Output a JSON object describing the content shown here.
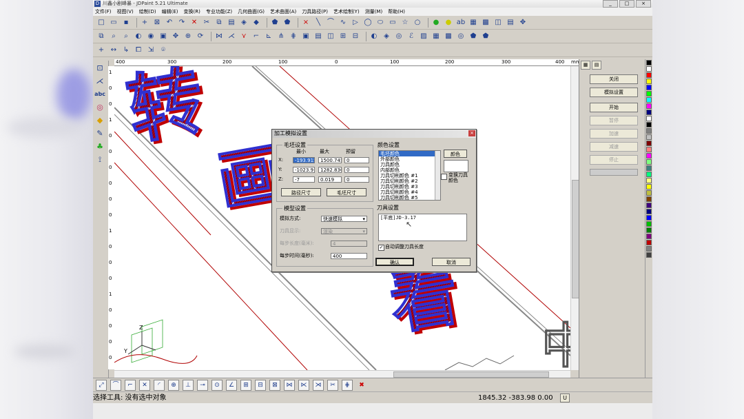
{
  "window": {
    "title": "川鑫小剧峰暴 - JDPaint 5.21 Ultimate",
    "minimize": "_",
    "maximize": "□",
    "close": "×"
  },
  "menu": [
    "文件(F)",
    "视图(V)",
    "绘制(D)",
    "编辑(E)",
    "变换(R)",
    "专业功能(Z)",
    "几何曲面(G)",
    "艺术曲面(A)",
    "刀具路径(P)",
    "艺术绘制(Y)",
    "测量(M)",
    "帮助(H)"
  ],
  "ruler_h": [
    "400",
    "300",
    "200",
    "100",
    "0",
    "100",
    "200",
    "300",
    "400",
    "mm"
  ],
  "ruler_v": [
    "1",
    "0",
    "0",
    "1",
    "0",
    "0",
    "0",
    "0",
    "0",
    "0",
    "1",
    "0",
    "0",
    "0",
    "1",
    "0",
    "0",
    "0",
    "0"
  ],
  "canvas": {
    "chars": [
      "转",
      "画",
      "看",
      "中"
    ]
  },
  "dialog": {
    "title": "加工模拟设置",
    "close": "×",
    "blank": {
      "label": "毛坯设置",
      "col_min": "最小",
      "col_max": "最大",
      "col_reserve": "预留",
      "rows": [
        {
          "axis": "X:",
          "min": "-193.915",
          "max": "1500.745",
          "reserve": "0"
        },
        {
          "axis": "Y:",
          "min": "-1023.9",
          "max": "1282.830",
          "reserve": "0"
        },
        {
          "axis": "Z:",
          "min": "-7",
          "max": "0.019",
          "reserve": "0"
        }
      ],
      "btn_path": "路径尺寸",
      "btn_blank": "毛坯尺寸"
    },
    "model": {
      "label": "模型设置",
      "mode_label": "模拟方式:",
      "mode_value": "快速模拟",
      "display_label": "刀具显示:",
      "display_value": "渲染",
      "step_len_label": "每步长度(毫米):",
      "step_len_value": "4",
      "step_time_label": "每步时间(毫秒):",
      "step_time_value": "400"
    },
    "colors": {
      "label": "颜色设置",
      "items": [
        "毛坯颜色",
        "外部颜色",
        "刀具颜色",
        "内部颜色",
        "刀具切削颜色 #1",
        "刀具切削颜色 #2",
        "刀具切削颜色 #3",
        "刀具切削颜色 #4",
        "刀具切削颜色 #5"
      ],
      "btn_color": "颜色",
      "per_tool_label": "变换刀具颜色"
    },
    "tool": {
      "label": "刀具设置",
      "value": "[平底]JD-3.17",
      "auto_adjust_label": "自动调整刀具长度",
      "auto_adjust_checked": "✓"
    },
    "ok": "确认",
    "cancel": "取消"
  },
  "right_panel": {
    "buttons": [
      "关闭",
      "模拟设置",
      "开始",
      "暂停",
      "加速",
      "减速",
      "停止"
    ]
  },
  "palette": [
    "#000000",
    "#ffffff",
    "#ff0000",
    "#ffff00",
    "#0000ff",
    "#00ff00",
    "#00ffff",
    "#ff00ff",
    "#000080",
    "#ffffff",
    "#000000",
    "#808080",
    "#c0c0c0",
    "#800000",
    "#ff8080",
    "#ff00ff",
    "#80ff80",
    "#408080",
    "#00ff80",
    "#ffff80",
    "#ffff00",
    "#c0c040",
    "#804000",
    "#400080",
    "#000080",
    "#0000ff",
    "#00c000",
    "#008000",
    "#800080",
    "#c00000",
    "#808080",
    "#404040"
  ],
  "status": {
    "text": "选择工具: 没有选中对象",
    "coords": "1845.32 -383.98 0.00",
    "unit": "U"
  }
}
